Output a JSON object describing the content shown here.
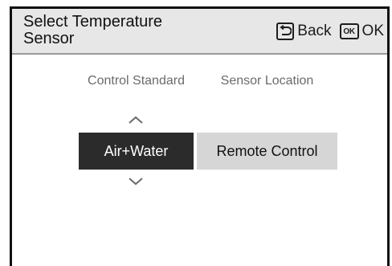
{
  "header": {
    "title": "Select Temperature Sensor",
    "back_label": "Back",
    "ok_icon_text": "OK",
    "ok_label": "OK"
  },
  "columns": {
    "control_standard": "Control Standard",
    "sensor_location": "Sensor Location"
  },
  "options": {
    "control_standard_value": "Air+Water",
    "sensor_location_value": "Remote Control"
  },
  "icons": {
    "back": "back-return-icon",
    "ok": "ok-key-icon",
    "scroll_up": "chevron-up-icon",
    "scroll_down": "chevron-down-icon"
  },
  "colors": {
    "header_bg": "#e7e7e7",
    "selected_bg": "#2b2b2b",
    "unselected_bg": "#d6d6d6",
    "label_gray": "#6b6b6b"
  }
}
